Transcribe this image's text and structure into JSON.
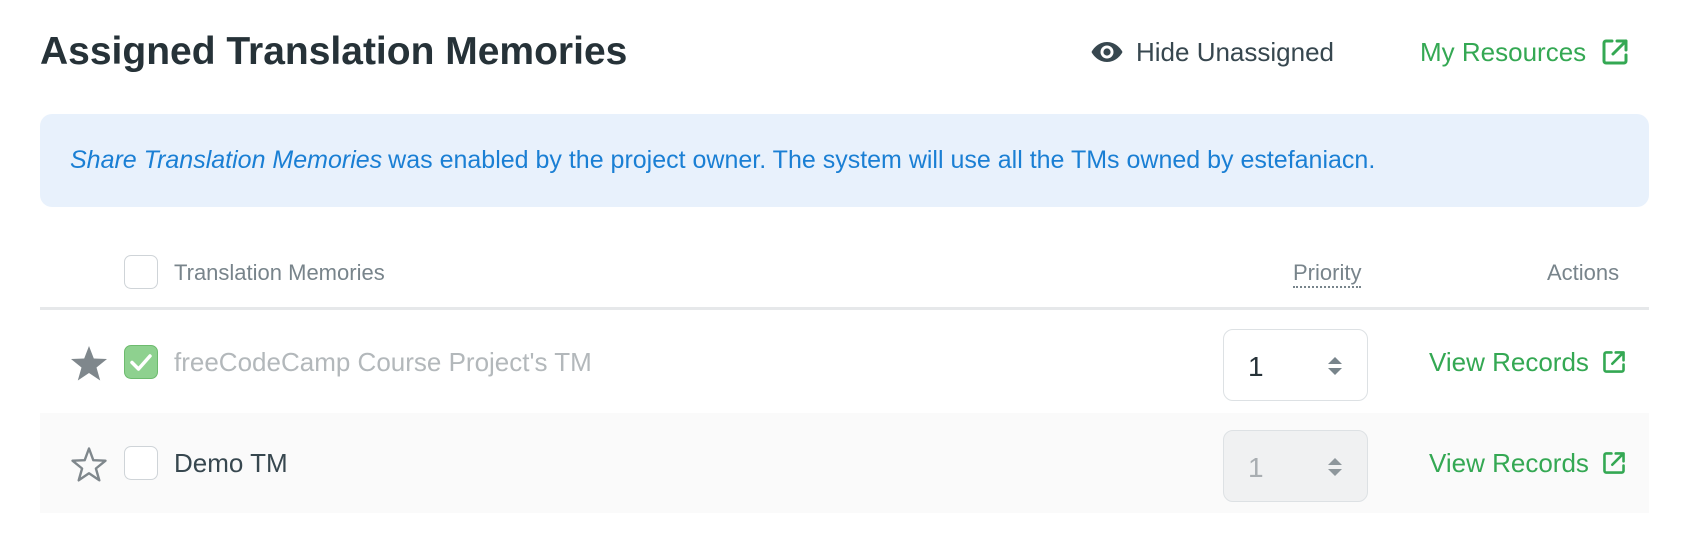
{
  "header": {
    "title": "Assigned Translation Memories",
    "hide_unassigned_label": "Hide Unassigned",
    "my_resources_label": "My Resources"
  },
  "notice": {
    "italic_text": "Share Translation Memories",
    "text": "was enabled by the project owner. The system will use all the TMs owned by estefaniacn."
  },
  "table": {
    "columns": {
      "name": "Translation Memories",
      "priority": "Priority",
      "actions": "Actions"
    },
    "rows": [
      {
        "name": "freeCodeCamp Course Project's TM",
        "starred": true,
        "checked": true,
        "priority": "1",
        "priority_enabled": true,
        "action_label": "View Records"
      },
      {
        "name": "Demo TM",
        "starred": false,
        "checked": false,
        "priority": "1",
        "priority_enabled": false,
        "action_label": "View Records"
      }
    ]
  },
  "colors": {
    "accent_green": "#34a853",
    "notice_blue": "#1a7fd4",
    "notice_background": "#e8f1fc",
    "checked_background": "#8ed18f"
  },
  "icons": {
    "hide_unassigned": "eye-icon",
    "external_link": "external-link-icon",
    "starred": "star-filled-icon",
    "unstarred": "star-outline-icon",
    "checkbox_checked": "check-icon",
    "stepper": "sort-arrows-icon"
  }
}
